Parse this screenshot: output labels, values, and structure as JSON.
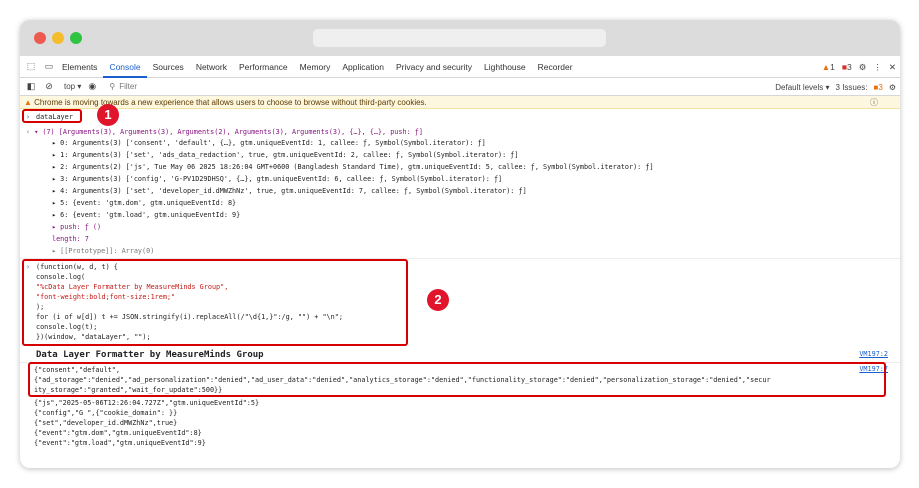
{
  "devtools": {
    "tabs": [
      "Elements",
      "Console",
      "Sources",
      "Network",
      "Performance",
      "Memory",
      "Application",
      "Privacy and security",
      "Lighthouse",
      "Recorder"
    ],
    "active_tab": "Console",
    "warn_count": "1",
    "error_count": "3"
  },
  "toolbar": {
    "context": "top ▾",
    "filter_placeholder": "Filter",
    "levels": "Default levels ▾",
    "issues": "3 Issues:",
    "issues_count": "3"
  },
  "banner": "Chrome is moving towards a new experience that allows users to choose to browse without third-party cookies.",
  "console": {
    "cmd1": "dataLayer",
    "array_summary": "▾ (7) [Arguments(3), Arguments(3), Arguments(2), Arguments(3), Arguments(3), {…}, {…}, push: ƒ]",
    "entries": [
      "▸ 0: Arguments(3) ['consent', 'default', {…}, gtm.uniqueEventId: 1, callee: ƒ, Symbol(Symbol.iterator): ƒ]",
      "▸ 1: Arguments(3) ['set', 'ads_data_redaction', true, gtm.uniqueEventId: 2, callee: ƒ, Symbol(Symbol.iterator): ƒ]",
      "▸ 2: Arguments(2) ['js', Tue May 06 2025 18:26:04 GMT+0600 (Bangladesh Standard Time), gtm.uniqueEventId: 5, callee: ƒ, Symbol(Symbol.iterator): ƒ]",
      "▸ 3: Arguments(3) ['config', 'G-PV1D29DHSQ', {…}, gtm.uniqueEventId: 6, callee: ƒ, Symbol(Symbol.iterator): ƒ]",
      "▸ 4: Arguments(3) ['set', 'developer_id.dMWZhNz', true, gtm.uniqueEventId: 7, callee: ƒ, Symbol(Symbol.iterator): ƒ]",
      "▸ 5: {event: 'gtm.dom', gtm.uniqueEventId: 8}",
      "▸ 6: {event: 'gtm.load', gtm.uniqueEventId: 9}",
      "▸ push: ƒ ()",
      "  length: 7",
      "▸ [[Prototype]]: Array(0)"
    ],
    "code_lines": [
      "(function(w, d, t) {",
      "  console.log(",
      "    \"%cData Layer Formatter by MeasureMinds Group\",",
      "    \"font-weight:bold;font-size:1rem;\"",
      "  );",
      "  for (i of w[d]) t += JSON.stringify(i).replaceAll(/\"\\d{1,}\":/g, \"\") + \"\\n\";",
      "  console.log(t);",
      "})(window, \"dataLayer\", \"\");"
    ],
    "formatter_title": "Data Layer Formatter by MeasureMinds Group",
    "src1": "VM197:2",
    "src2": "VM197:7",
    "output_lines": [
      "{\"consent\",\"default\",",
      "{\"ad_storage\":\"denied\",\"ad_personalization\":\"denied\",\"ad_user_data\":\"denied\",\"analytics_storage\":\"denied\",\"functionality_storage\":\"denied\",\"personalization_storage\":\"denied\",\"secur",
      "ity_storage\":\"granted\",\"wait_for_update\":500}}",
      "{\"js\",\"2025-05-06T12:26:04.727Z\",\"gtm.uniqueEventId\":5}",
      "{\"config\",\"G            \",{\"cookie_domain\":                        }}",
      "{\"set\",\"developer_id.dMWZhNz\",true}",
      "{\"event\":\"gtm.dom\",\"gtm.uniqueEventId\":8}",
      "{\"event\":\"gtm.load\",\"gtm.uniqueEventId\":9}"
    ]
  },
  "markers": {
    "one": "1",
    "two": "2"
  }
}
